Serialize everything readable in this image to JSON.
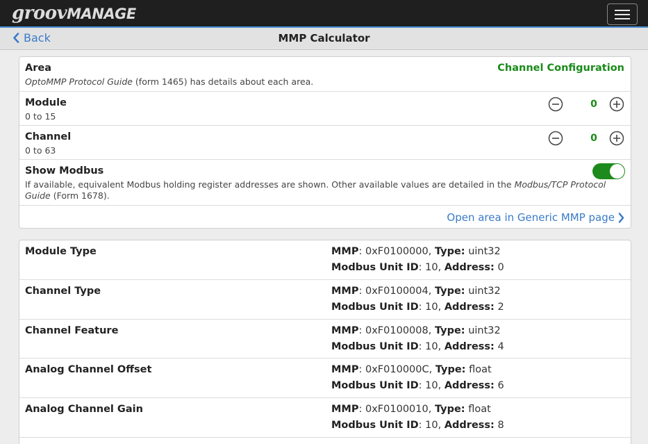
{
  "app": {
    "logo_part1": "groov",
    "logo_part2": "MANAGE"
  },
  "nav": {
    "back_label": "Back",
    "title": "MMP Calculator"
  },
  "config": {
    "area": {
      "label": "Area",
      "desc_italic": "OptoMMP Protocol Guide",
      "desc_rest": " (form 1465) has details about each area.",
      "value": "Channel Configuration"
    },
    "module": {
      "label": "Module",
      "range": "0 to 15",
      "value": "0"
    },
    "channel": {
      "label": "Channel",
      "range": "0 to 63",
      "value": "0"
    },
    "modbus": {
      "label": "Show Modbus",
      "desc_part1": "If available, equivalent Modbus holding register addresses are shown. Other available values are detailed in the ",
      "desc_italic": "Modbus/TCP Protocol Guide",
      "desc_part2": " (Form 1678).",
      "enabled": true
    },
    "open_link": "Open area in Generic MMP page"
  },
  "labels": {
    "mmp": "MMP",
    "type": "Type:",
    "unit_id": "Modbus Unit ID",
    "address": "Address:"
  },
  "registers": [
    {
      "name": "Module Type",
      "mmp": "0xF0100000",
      "type": "uint32",
      "unit_id": "10",
      "address": "0"
    },
    {
      "name": "Channel Type",
      "mmp": "0xF0100004",
      "type": "uint32",
      "unit_id": "10",
      "address": "2"
    },
    {
      "name": "Channel Feature",
      "mmp": "0xF0100008",
      "type": "uint32",
      "unit_id": "10",
      "address": "4"
    },
    {
      "name": "Analog Channel Offset",
      "mmp": "0xF010000C",
      "type": "float",
      "unit_id": "10",
      "address": "6"
    },
    {
      "name": "Analog Channel Gain",
      "mmp": "0xF0100010",
      "type": "float",
      "unit_id": "10",
      "address": "8"
    }
  ]
}
